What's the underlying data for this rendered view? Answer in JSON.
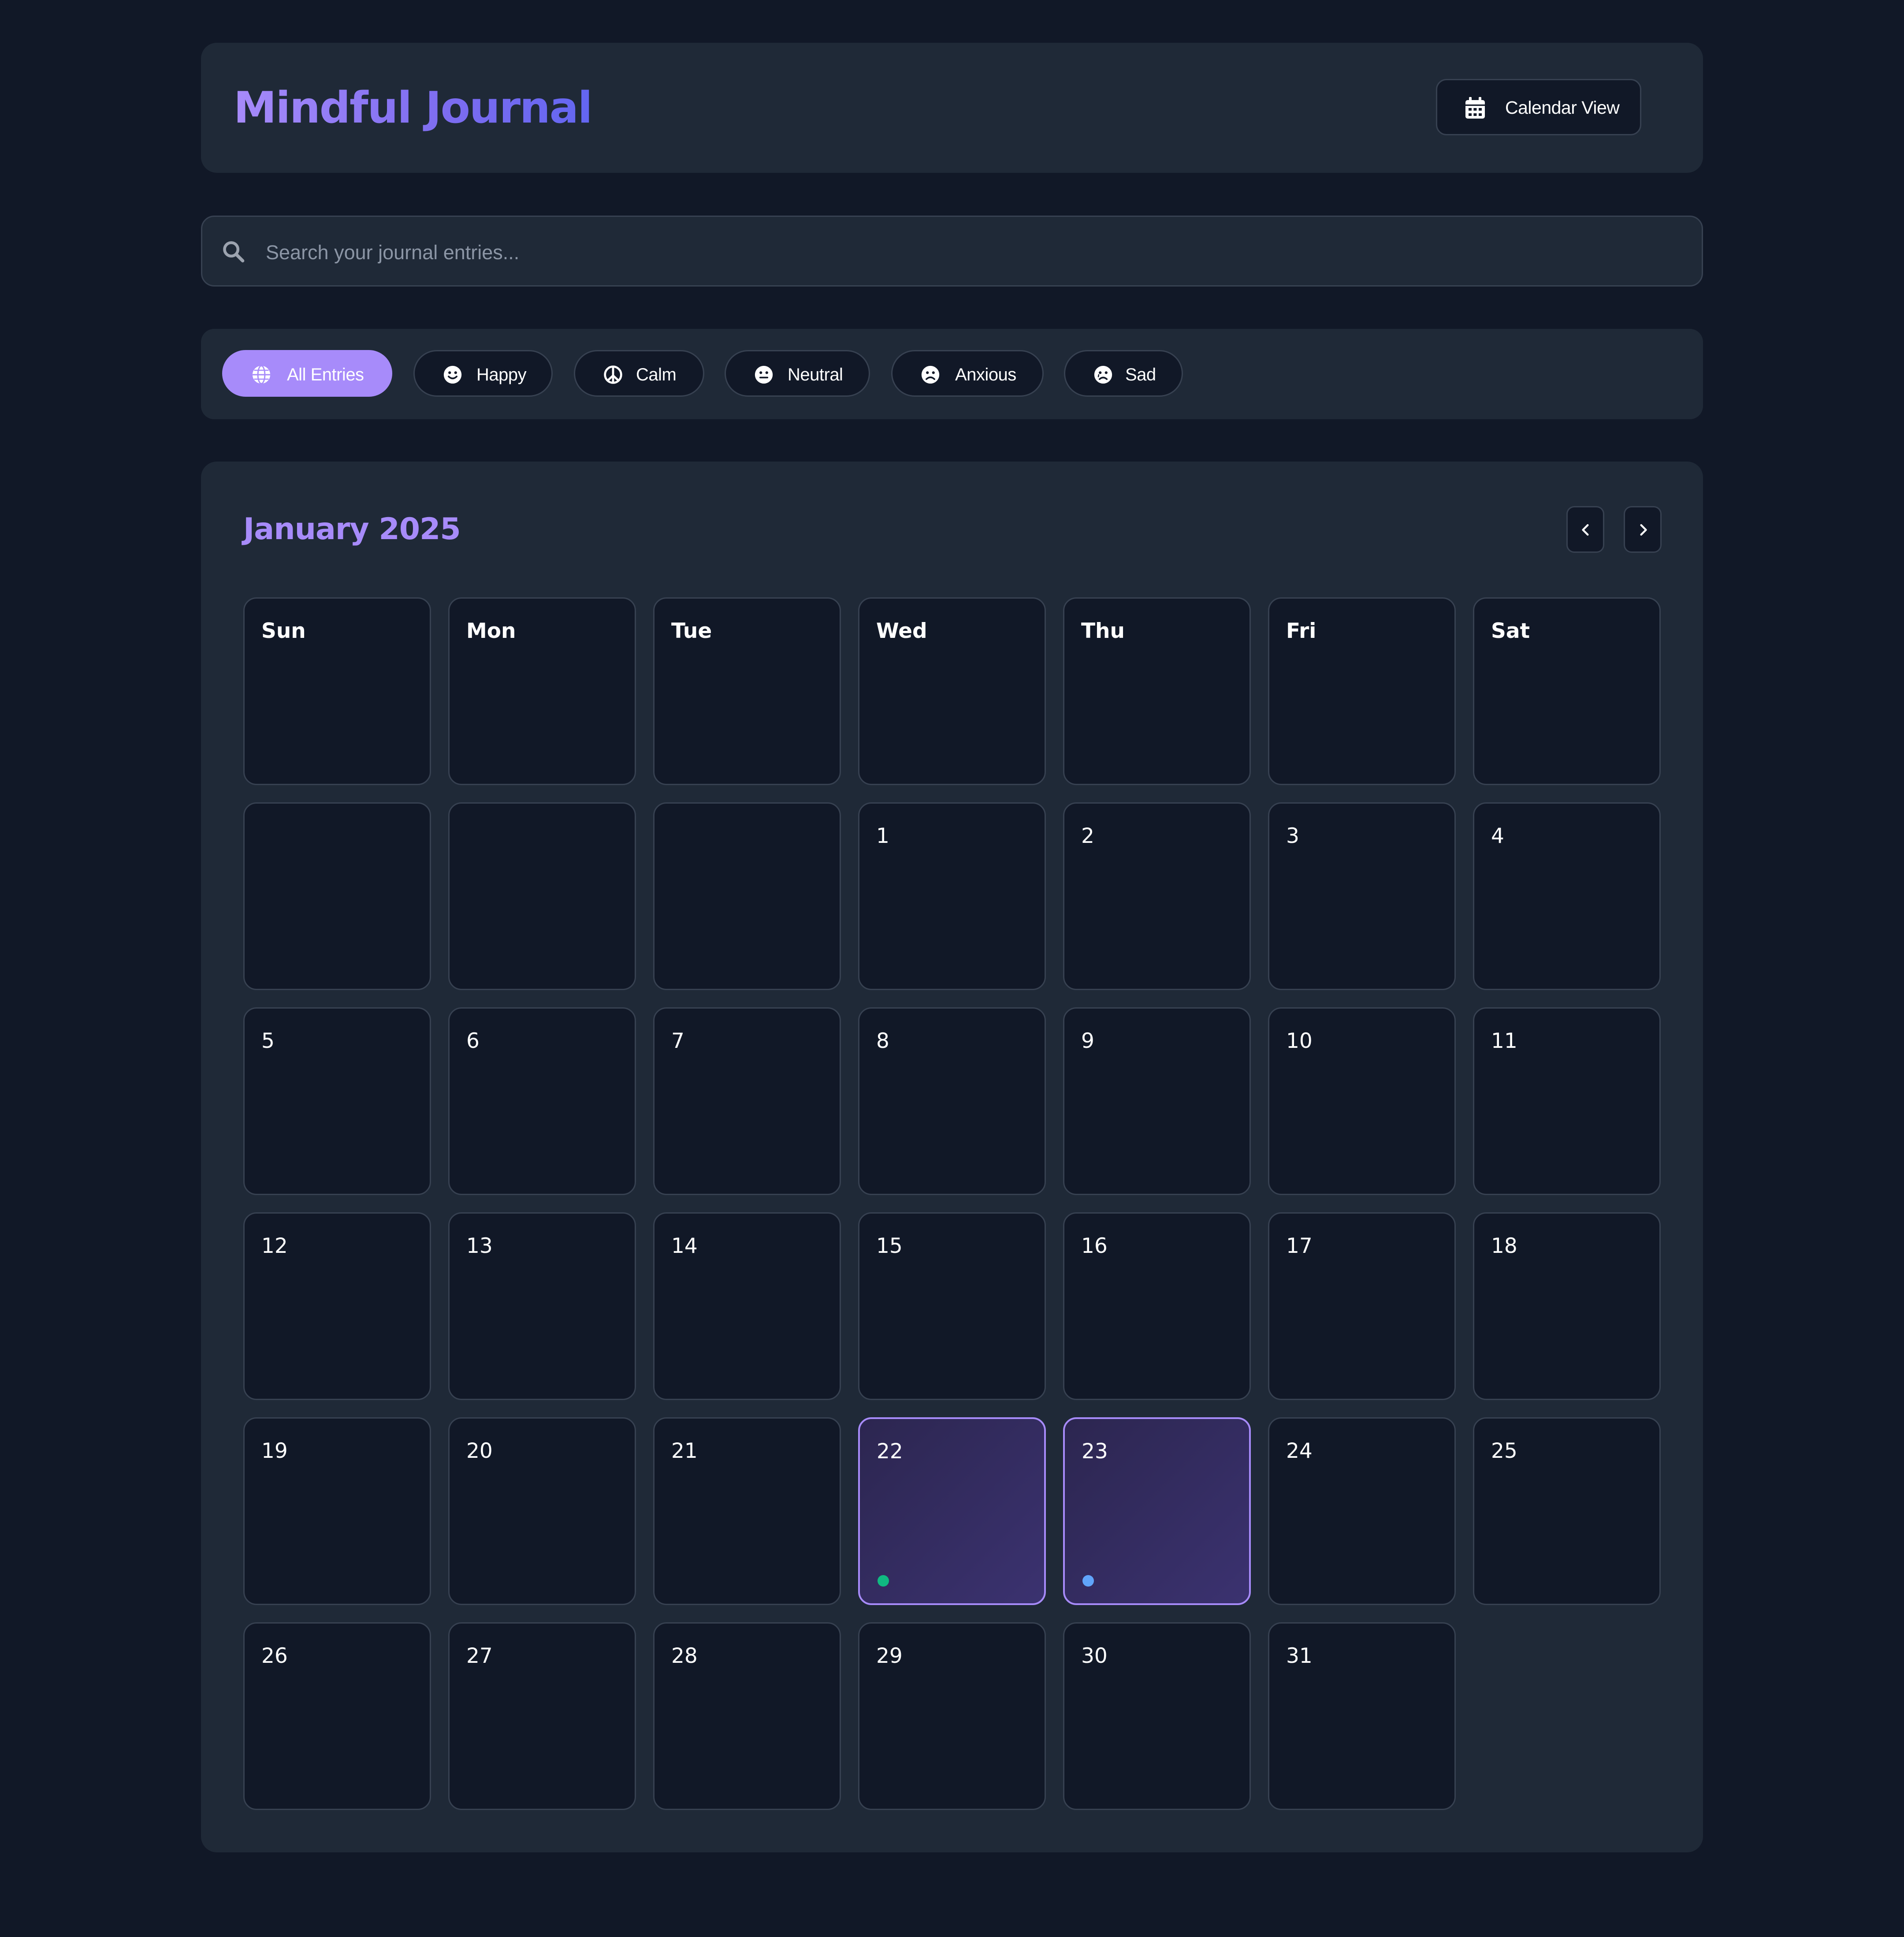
{
  "header": {
    "title": "Mindful Journal",
    "calendar_view_label": "Calendar View",
    "calendar_view_icon": "calendar-icon"
  },
  "search": {
    "icon": "search-icon",
    "placeholder": "Search your journal entries...",
    "value": ""
  },
  "filters": [
    {
      "label": "All Entries",
      "icon": "globe-icon",
      "active": true
    },
    {
      "label": "Happy",
      "icon": "smile-icon",
      "active": false
    },
    {
      "label": "Calm",
      "icon": "peace-icon",
      "active": false
    },
    {
      "label": "Neutral",
      "icon": "neutral-face-icon",
      "active": false
    },
    {
      "label": "Anxious",
      "icon": "frown-icon",
      "active": false
    },
    {
      "label": "Sad",
      "icon": "sad-face-icon",
      "active": false
    }
  ],
  "calendar": {
    "month_title": "January 2025",
    "prev_icon": "chevron-left-icon",
    "next_icon": "chevron-right-icon",
    "weekdays": [
      "Sun",
      "Mon",
      "Tue",
      "Wed",
      "Thu",
      "Fri",
      "Sat"
    ],
    "leading_blank_days": 3,
    "days_in_month": 31,
    "entries": [
      {
        "day": 22,
        "mood_color": "#10b981"
      },
      {
        "day": 23,
        "mood_color": "#60a5fa"
      }
    ]
  },
  "colors": {
    "background": "#111827",
    "card": "#1f2937",
    "border": "#374151",
    "accent": "#a78bfa",
    "entry_border": "#a78bfa"
  }
}
